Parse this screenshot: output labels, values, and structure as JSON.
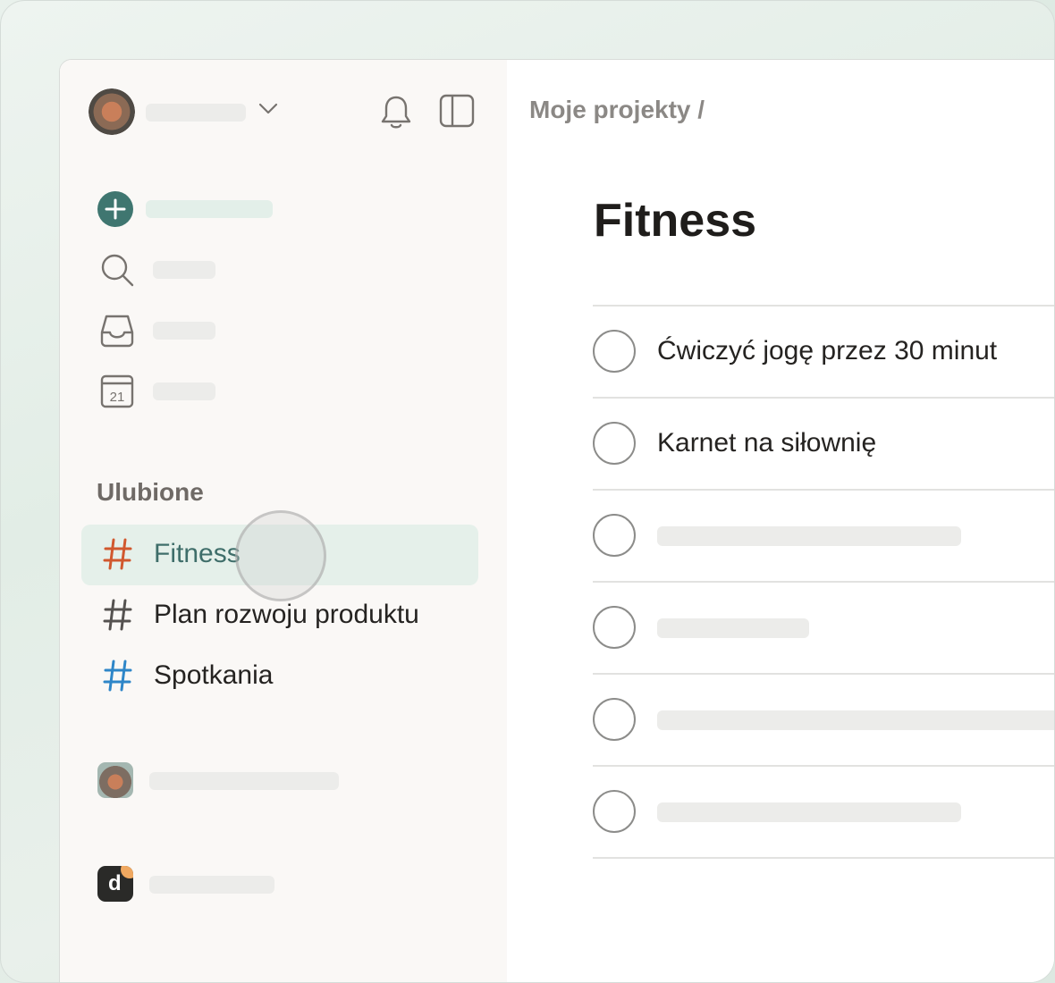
{
  "sidebar": {
    "favorites_title": "Ulubione",
    "favorites": [
      {
        "label": "Fitness",
        "color": "#d1582e",
        "active": true
      },
      {
        "label": "Plan rozwoju produktu",
        "color": "#555250",
        "active": false
      },
      {
        "label": "Spotkania",
        "color": "#2e86c8",
        "active": false
      }
    ],
    "calendar_day": "21"
  },
  "main": {
    "breadcrumb": "Moje projekty /",
    "title": "Fitness",
    "tasks": [
      {
        "label": "Ćwiczyć jogę przez 30 minut"
      },
      {
        "label": "Karnet na siłownię"
      }
    ]
  },
  "colors": {
    "accent": "#3f7670",
    "active_row": "#e5f0ea",
    "placeholder": "#ececea"
  },
  "icons": [
    "chevron-down-icon",
    "bell-icon",
    "sidebar-toggle-icon",
    "plus-icon",
    "search-icon",
    "inbox-icon",
    "calendar-icon",
    "hash-icon"
  ]
}
